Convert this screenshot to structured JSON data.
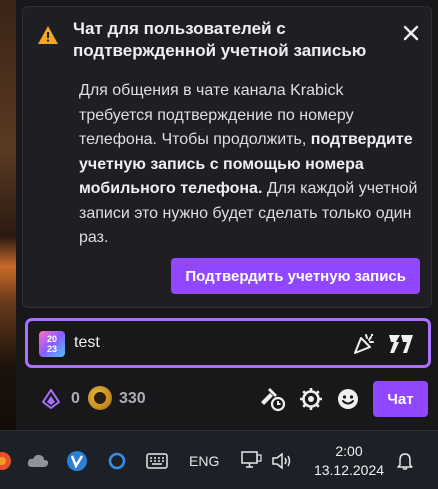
{
  "notice": {
    "title": "Чат для пользователей с подтвержденной учетной записью",
    "body_part1": "Для общения в чате канала Krabick требуется подтверждение по номеру телефона. Чтобы продолжить, ",
    "body_bold": "подтвердите учетную запись с помощью номера мобильного телефона.",
    "body_part2": " Для каждой учетной записи это нужно будет сделать только один раз.",
    "verify_label": "Подтвердить учетную запись",
    "icons": [
      "warning-icon",
      "close-icon"
    ],
    "warning_color": "#f5a623"
  },
  "chat_input": {
    "value": "test",
    "badge_line1": "20",
    "badge_line2": "23",
    "icons": [
      "party-icon",
      "7tv-icon"
    ],
    "border_color": "#a970ff"
  },
  "bottom_bar": {
    "bits": "0",
    "points": "330",
    "chat_button": "Чат",
    "icons": [
      "bits-icon",
      "channel-points-icon",
      "mod-tools-icon",
      "settings-icon",
      "emote-icon"
    ],
    "accent": "#9147ff"
  },
  "taskbar": {
    "language": "ENG",
    "time": "2:00",
    "date": "13.12.2024",
    "icons": [
      "browser-icon",
      "cloud-icon",
      "vk-icon",
      "circle-app-icon",
      "keyboard-icon",
      "network-icon",
      "volume-icon",
      "notification-bell-icon"
    ]
  }
}
